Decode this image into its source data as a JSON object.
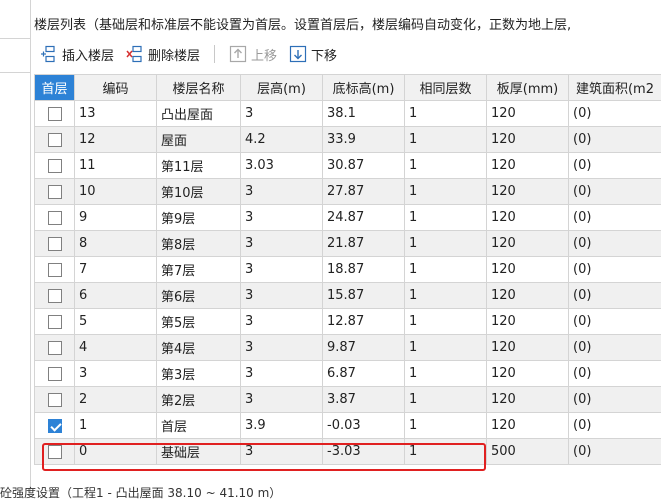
{
  "header": {
    "title": "楼层列表（基础层和标准层不能设置为首层。设置首层后，楼层编码自动变化，正数为地上层,"
  },
  "toolbar": {
    "insert_label": "插入楼层",
    "delete_label": "删除楼层",
    "move_up_label": "上移",
    "move_down_label": "下移"
  },
  "table": {
    "columns": [
      "首层",
      "编码",
      "楼层名称",
      "层高(m)",
      "底标高(m)",
      "相同层数",
      "板厚(mm)",
      "建筑面积(m2"
    ],
    "rows": [
      {
        "first": false,
        "code": "13",
        "name": "凸出屋面",
        "height": "3",
        "elevation": "38.1",
        "same": "1",
        "thickness": "120",
        "area": "(0)"
      },
      {
        "first": false,
        "code": "12",
        "name": "屋面",
        "height": "4.2",
        "elevation": "33.9",
        "same": "1",
        "thickness": "120",
        "area": "(0)"
      },
      {
        "first": false,
        "code": "11",
        "name": "第11层",
        "height": "3.03",
        "elevation": "30.87",
        "same": "1",
        "thickness": "120",
        "area": "(0)"
      },
      {
        "first": false,
        "code": "10",
        "name": "第10层",
        "height": "3",
        "elevation": "27.87",
        "same": "1",
        "thickness": "120",
        "area": "(0)"
      },
      {
        "first": false,
        "code": "9",
        "name": "第9层",
        "height": "3",
        "elevation": "24.87",
        "same": "1",
        "thickness": "120",
        "area": "(0)"
      },
      {
        "first": false,
        "code": "8",
        "name": "第8层",
        "height": "3",
        "elevation": "21.87",
        "same": "1",
        "thickness": "120",
        "area": "(0)"
      },
      {
        "first": false,
        "code": "7",
        "name": "第7层",
        "height": "3",
        "elevation": "18.87",
        "same": "1",
        "thickness": "120",
        "area": "(0)"
      },
      {
        "first": false,
        "code": "6",
        "name": "第6层",
        "height": "3",
        "elevation": "15.87",
        "same": "1",
        "thickness": "120",
        "area": "(0)"
      },
      {
        "first": false,
        "code": "5",
        "name": "第5层",
        "height": "3",
        "elevation": "12.87",
        "same": "1",
        "thickness": "120",
        "area": "(0)"
      },
      {
        "first": false,
        "code": "4",
        "name": "第4层",
        "height": "3",
        "elevation": "9.87",
        "same": "1",
        "thickness": "120",
        "area": "(0)"
      },
      {
        "first": false,
        "code": "3",
        "name": "第3层",
        "height": "3",
        "elevation": "6.87",
        "same": "1",
        "thickness": "120",
        "area": "(0)"
      },
      {
        "first": false,
        "code": "2",
        "name": "第2层",
        "height": "3",
        "elevation": "3.87",
        "same": "1",
        "thickness": "120",
        "area": "(0)"
      },
      {
        "first": true,
        "code": "1",
        "name": "首层",
        "height": "3.9",
        "elevation": "-0.03",
        "same": "1",
        "thickness": "120",
        "area": "(0)"
      },
      {
        "first": false,
        "code": "0",
        "name": "基础层",
        "height": "3",
        "elevation": "-3.03",
        "same": "1",
        "thickness": "500",
        "area": "(0)"
      }
    ]
  },
  "footer": {
    "text": "砼强度设置（工程1 - 凸出屋面 38.10 ~ 41.10 m）"
  },
  "colors": {
    "accent": "#2d82d6",
    "highlight": "#e02020"
  }
}
